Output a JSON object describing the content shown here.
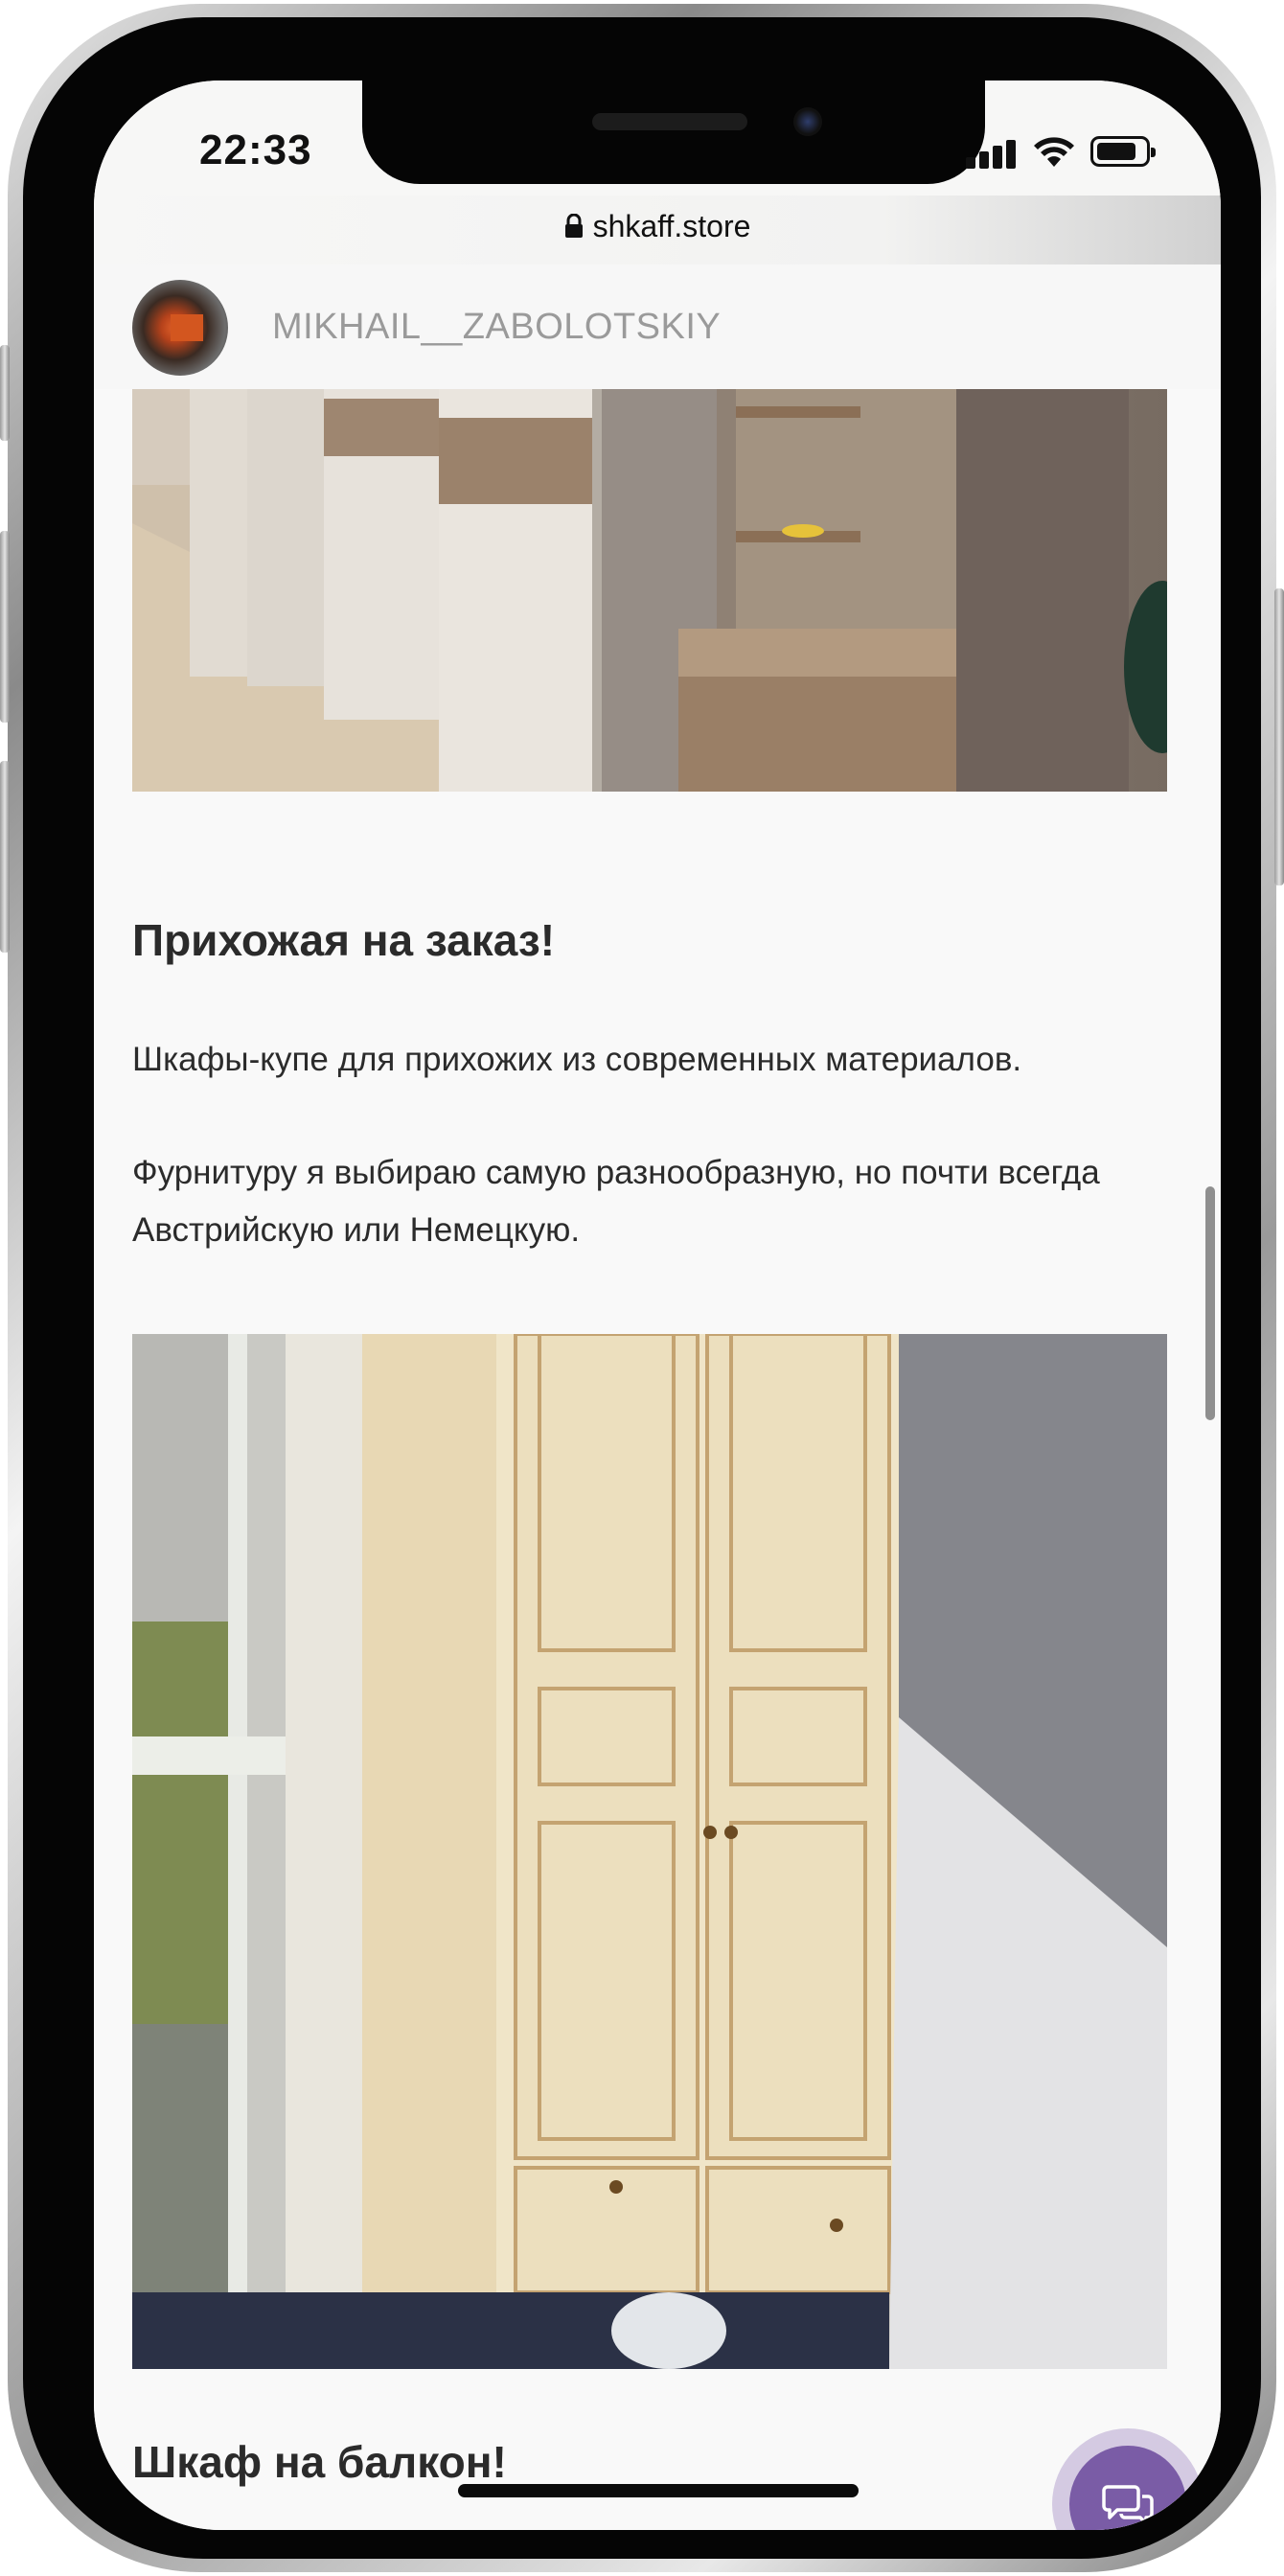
{
  "status_bar": {
    "time": "22:33"
  },
  "browser": {
    "url": "shkaff.store"
  },
  "profile": {
    "username": "MIKHAIL__ZABOLOTSKIY"
  },
  "posts": [
    {
      "title": "Прихожая на заказ!",
      "paragraphs": [
        "Шкафы-купе для прихожих из современных материалов.",
        "Фурнитуру я выбираю самую разнообразную, но почти всегда Австрийскую или Немецкую."
      ]
    },
    {
      "title": "Шкаф на балкон!"
    }
  ],
  "colors": {
    "accent": "#7a5ca6",
    "username": "#9a9a9a",
    "text": "#2b2b2b"
  },
  "icons": {
    "lock": "lock-icon",
    "chat": "chat-bubbles-icon",
    "wifi": "wifi-icon",
    "signal": "signal-icon",
    "battery": "battery-icon"
  }
}
